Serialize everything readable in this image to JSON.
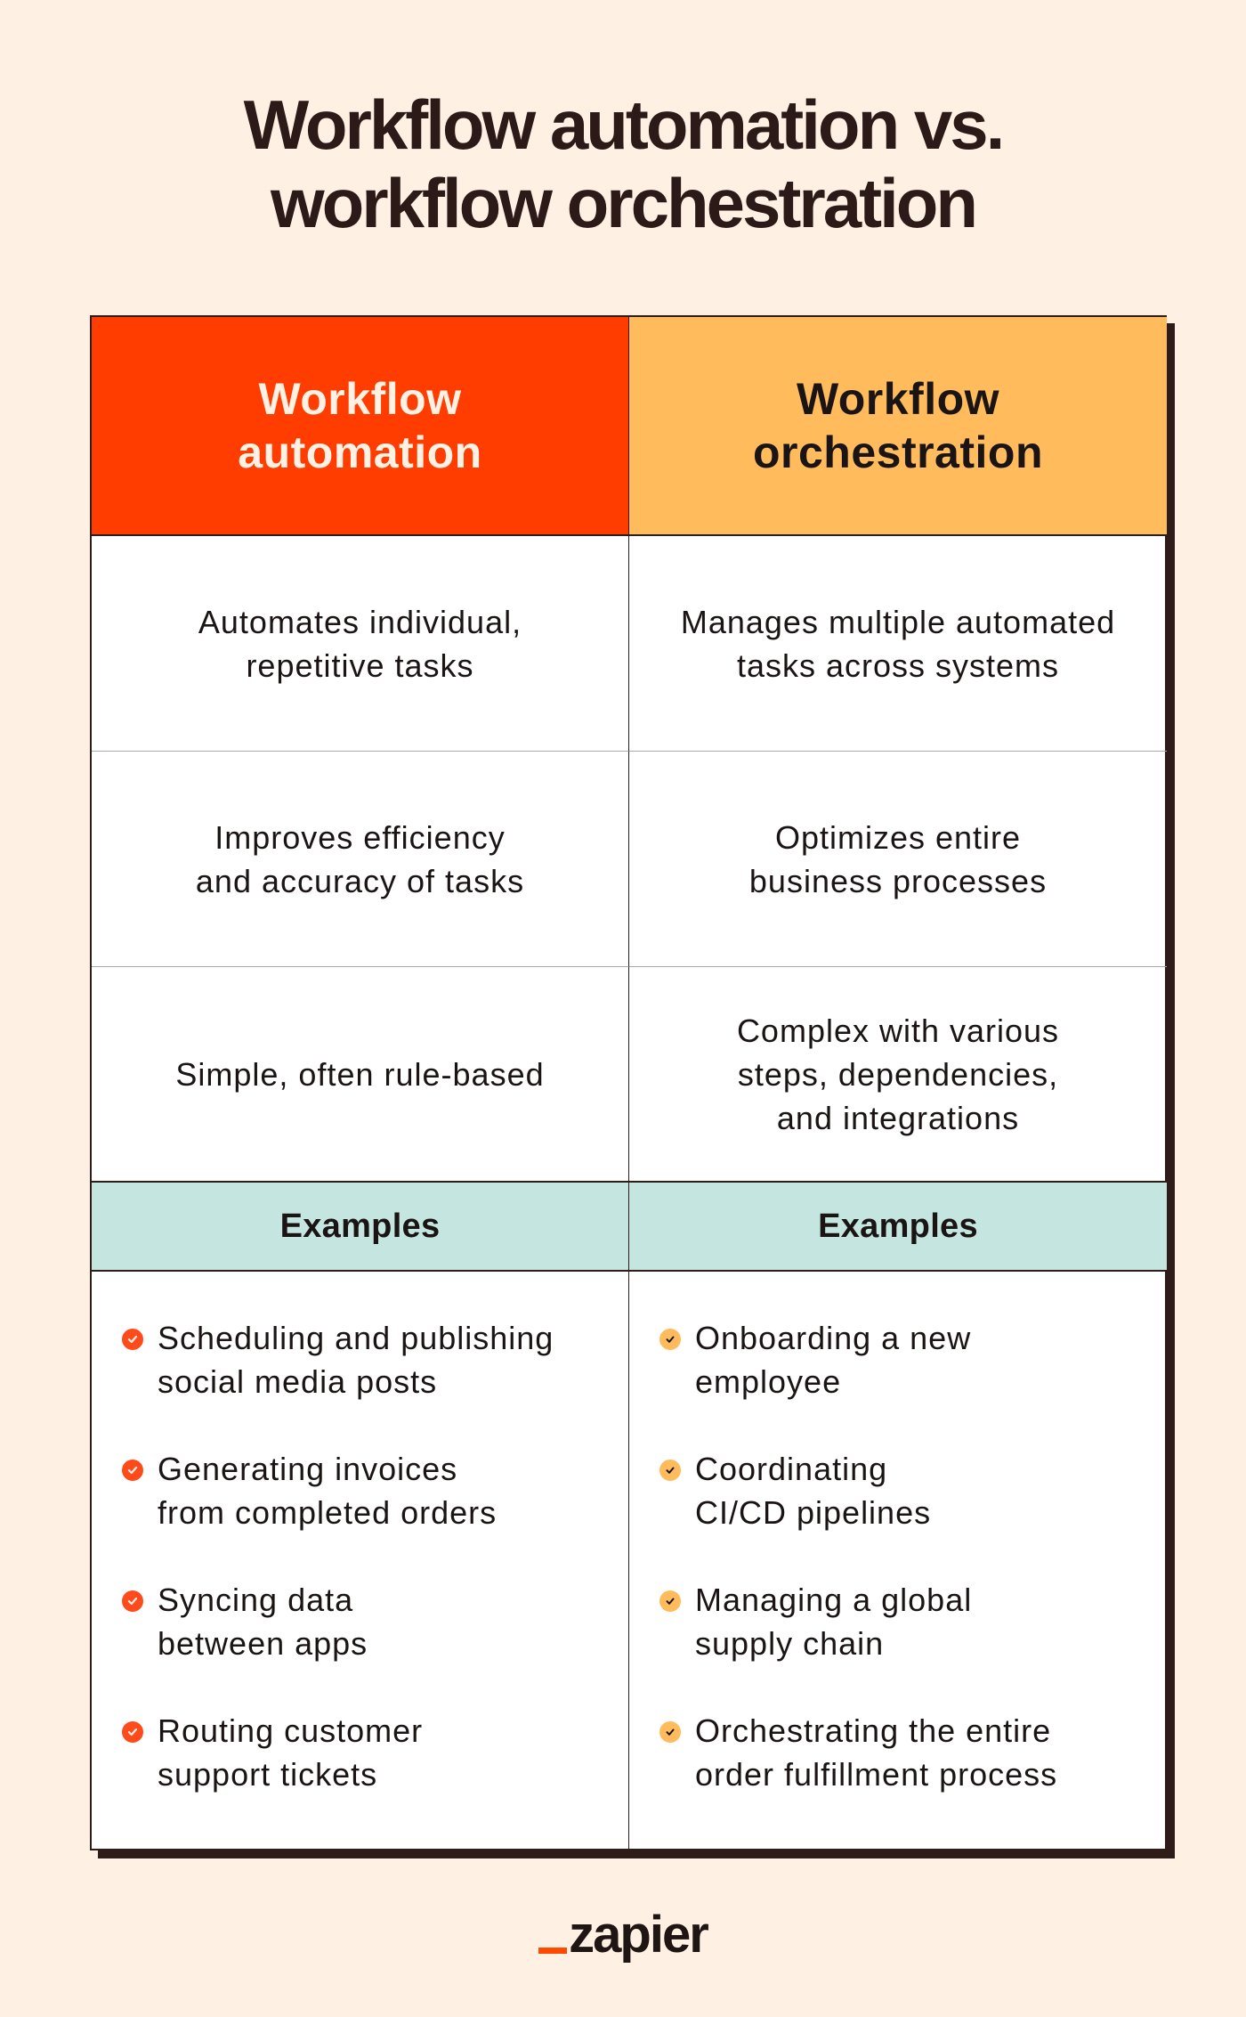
{
  "title": {
    "line1": "Workflow automation vs.",
    "line2": "workflow orchestration"
  },
  "colors": {
    "background": "#fef1e4",
    "automation_header": "#ff3d00",
    "orchestration_header": "#ffbb5c",
    "examples_band": "#c5e5e0",
    "automation_check": "#ff4a1c",
    "orchestration_check": "#ffbb5c",
    "border": "#2d1c1a",
    "logo_accent": "#ff4a00"
  },
  "table": {
    "columns": [
      {
        "header_line1": "Workflow",
        "header_line2": "automation",
        "rows": [
          [
            "Automates individual,",
            "repetitive tasks"
          ],
          [
            "Improves efficiency",
            "and accuracy of tasks"
          ],
          [
            "Simple, often rule-based"
          ]
        ],
        "examples_label": "Examples",
        "check_icon": "check-circle-icon",
        "examples": [
          [
            "Scheduling and publishing",
            "social media posts"
          ],
          [
            "Generating invoices",
            "from completed orders"
          ],
          [
            "Syncing data",
            "between apps"
          ],
          [
            "Routing customer",
            "support tickets"
          ]
        ]
      },
      {
        "header_line1": "Workflow",
        "header_line2": "orchestration",
        "rows": [
          [
            "Manages multiple automated",
            "tasks across systems"
          ],
          [
            "Optimizes entire",
            "business processes"
          ],
          [
            "Complex with various",
            "steps, dependencies,",
            "and integrations"
          ]
        ],
        "examples_label": "Examples",
        "check_icon": "check-circle-icon",
        "examples": [
          [
            "Onboarding a new",
            "employee"
          ],
          [
            "Coordinating",
            "CI/CD pipelines"
          ],
          [
            "Managing a global",
            "supply chain"
          ],
          [
            "Orchestrating the entire",
            "order fulfillment process"
          ]
        ]
      }
    ]
  },
  "logo": {
    "text": "zapier"
  }
}
